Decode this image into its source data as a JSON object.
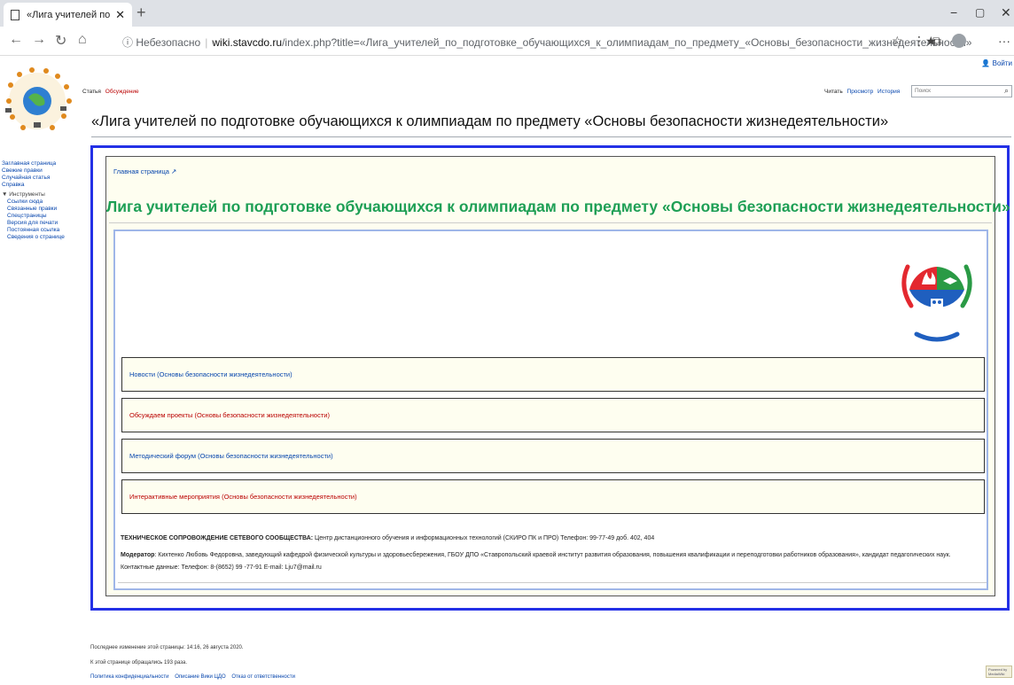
{
  "browser": {
    "tab_title": "«Лига учителей по подготовке",
    "tab_close": "✕",
    "new_tab": "+",
    "back": "←",
    "forward": "→",
    "reload": "↻",
    "home": "⌂",
    "security_icon": "ⓘ",
    "security_label": "Небезопасно",
    "url_host": "wiki.stavcdo.ru",
    "url_path": "/index.php?title=«Лига_учителей_по_подготовке_обучающихся_к_олимпиадам_по_предмету_«Основы_безопасности_жизнедеятельности»",
    "star_icon": "☆",
    "favorites_icon": "⋮★",
    "collections_icon": "⧉",
    "more_icon": "···",
    "minimize": "−",
    "maximize": "▢",
    "close": "✕"
  },
  "header": {
    "login_label": "Войти",
    "page_tabs": [
      "Статья",
      "Обсуждение"
    ],
    "view_tabs": [
      "Читать",
      "Просмотр",
      "История"
    ],
    "search_placeholder": "Поиск"
  },
  "sidebar": {
    "nav": [
      "Заглавная страница",
      "Свежие правки",
      "Случайная статья",
      "Справка"
    ],
    "tools_label": "▼ Инструменты",
    "tools": [
      "Ссылки сюда",
      "Связанные правки",
      "Спецстраницы",
      "Версия для печати",
      "Постоянная ссылка",
      "Сведения о странице"
    ]
  },
  "page": {
    "title": "«Лига учителей по подготовке обучающихся к олимпиадам по предмету «Основы безопасности жизнедеятельности»",
    "breadcrumb": "Главная страница",
    "league_title": "Лига учителей по подготовке обучающихся к олимпиадам по предмету «Основы безопасности жизнедеятельности»",
    "links": [
      {
        "label": "Новости (Основы безопасности жизнедеятельности)",
        "color": "#0645ad"
      },
      {
        "label": "Обсуждаем проекты (Основы безопасности жизнедеятельности)",
        "color": "#ba0000"
      },
      {
        "label": "Методический форум (Основы безопасности жизнедеятельности)",
        "color": "#0645ad"
      },
      {
        "label": "Интерактивные мероприятия (Основы безопасности жизнедеятельности)",
        "color": "#ba0000"
      }
    ],
    "support_label": "ТЕХНИЧЕСКОЕ СОПРОВОЖДЕНИЕ СЕТЕВОГО СООБЩЕСТВА:",
    "support_text": "Центр дистанционного обучения и информационных технологий (СКИРО ПК и ПРО) Телефон: 99-77-49 доб. 402, 404",
    "moderator_label": "Модератор",
    "moderator_text": ": Кихтенко Любовь Федоровна, заведующий кафедрой физической культуры и здоровьесбережения, ГБОУ ДПО «Ставропольский краевой институт развития образования, повышения квалификации и переподготовки работников образования», кандидат педагогических наук.",
    "contacts": "Контактные данные: Телефон: 8-(8652) 99 -77-91 E-mail: Lju7@mail.ru"
  },
  "footer": {
    "last_modified": "Последнее изменение этой страницы: 14:16, 26 августа 2020.",
    "views": "К этой странице обращались 193 раза.",
    "links": [
      "Политика конфиденциальности",
      "Описание Вики ЦДО",
      "Отказ от ответственности"
    ],
    "badge": "Powered by MediaWiki"
  },
  "colors": {
    "accent_border": "#2431e6",
    "league_green": "#1e9f55",
    "link_blue": "#0645ad",
    "link_red": "#ba0000"
  }
}
